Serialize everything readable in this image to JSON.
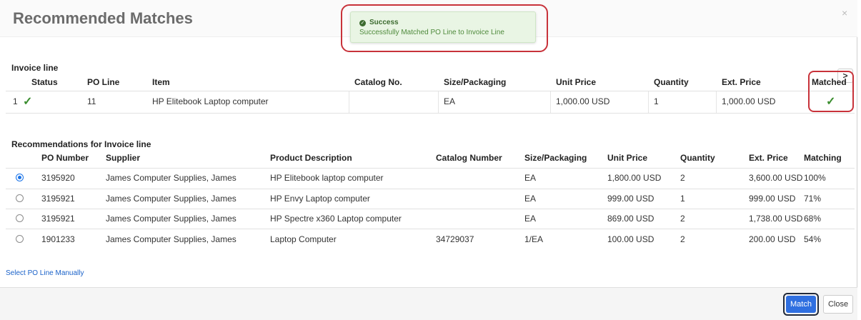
{
  "dialog": {
    "title": "Recommended Matches",
    "close_glyph": "×"
  },
  "toast": {
    "title": "Success",
    "message": "Successfully Matched PO Line to Invoice Line",
    "icon": "check-circle-icon"
  },
  "nav": {
    "next_glyph": ">"
  },
  "invoice_line": {
    "section_label": "Invoice line",
    "headers": [
      "Status",
      "PO Line",
      "Item",
      "Catalog No.",
      "Size/Packaging",
      "Unit Price",
      "Quantity",
      "Ext. Price",
      "Matched"
    ],
    "rows": [
      {
        "index": "1",
        "status": "✓",
        "po_line": "11",
        "item": "HP Elitebook Laptop computer",
        "catalog_no": "",
        "size_packaging": "EA",
        "unit_price": "1,000.00 USD",
        "quantity": "1",
        "ext_price": "1,000.00 USD",
        "matched": "✓"
      }
    ]
  },
  "recommendations": {
    "section_label": "Recommendations for Invoice line",
    "headers": [
      "PO Number",
      "Supplier",
      "Product Description",
      "Catalog Number",
      "Size/Packaging",
      "Unit Price",
      "Quantity",
      "Ext. Price",
      "Matching"
    ],
    "rows": [
      {
        "selected": true,
        "po_number": "3195920",
        "supplier": "James Computer Supplies, James",
        "description": "HP Elitebook laptop computer",
        "catalog_number": "",
        "size_packaging": "EA",
        "unit_price": "1,800.00 USD",
        "quantity": "2",
        "ext_price": "3,600.00 USD",
        "matching": "100%"
      },
      {
        "selected": false,
        "po_number": "3195921",
        "supplier": "James Computer Supplies, James",
        "description": "HP Envy Laptop computer",
        "catalog_number": "",
        "size_packaging": "EA",
        "unit_price": "999.00 USD",
        "quantity": "1",
        "ext_price": "999.00 USD",
        "matching": "71%"
      },
      {
        "selected": false,
        "po_number": "3195921",
        "supplier": "James Computer Supplies, James",
        "description": "HP Spectre x360 Laptop computer",
        "catalog_number": "",
        "size_packaging": "EA",
        "unit_price": "869.00 USD",
        "quantity": "2",
        "ext_price": "1,738.00 USD",
        "matching": "68%"
      },
      {
        "selected": false,
        "po_number": "1901233",
        "supplier": "James Computer Supplies, James",
        "description": "Laptop Computer",
        "catalog_number": "34729037",
        "size_packaging": "1/EA",
        "unit_price": "100.00 USD",
        "quantity": "2",
        "ext_price": "200.00 USD",
        "matching": "54%"
      }
    ]
  },
  "manual_link": "Select PO Line Manually",
  "footer": {
    "match_label": "Match",
    "close_label": "Close"
  },
  "colors": {
    "primary": "#2f6fe0",
    "success": "#3a8d2e",
    "highlight_ring": "#c8323a"
  }
}
